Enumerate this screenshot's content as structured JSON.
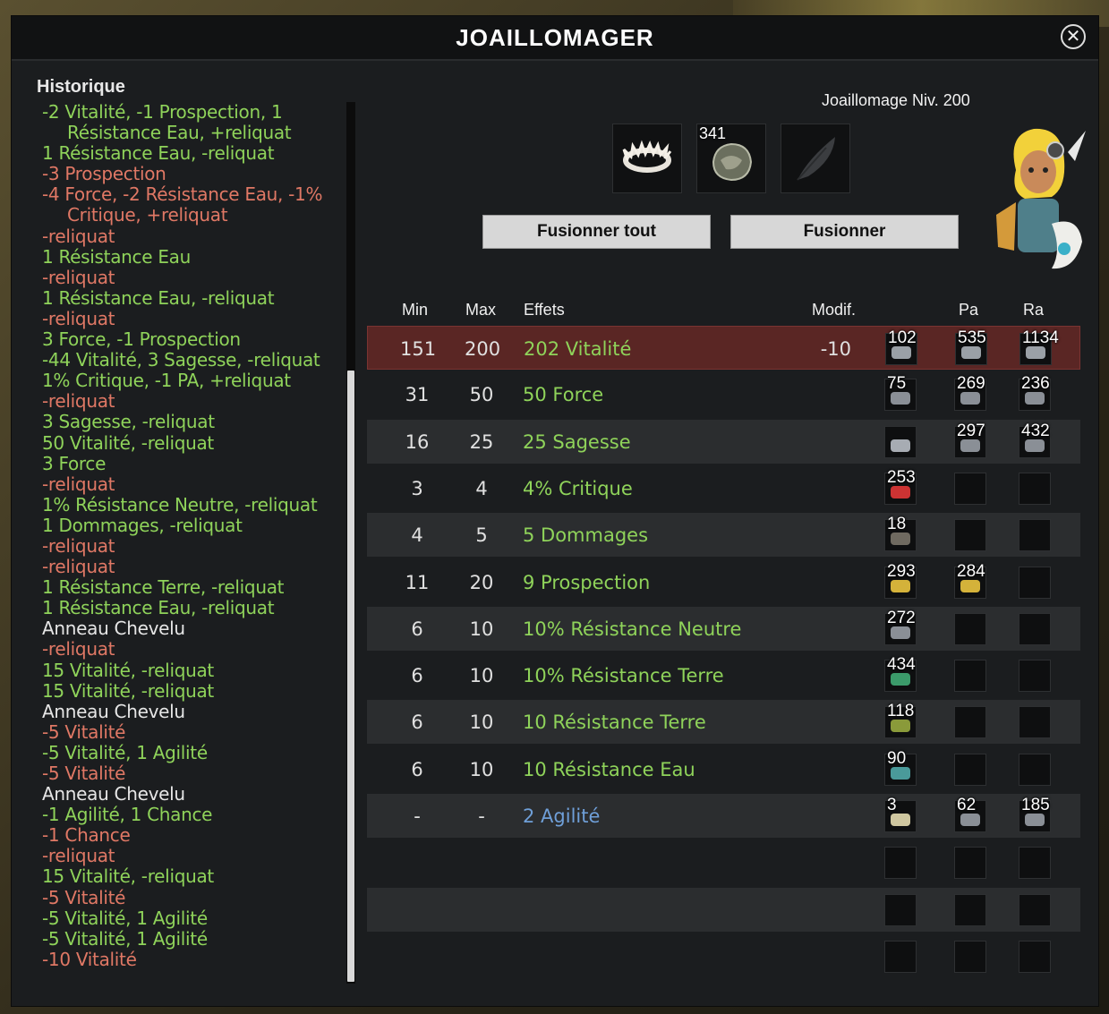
{
  "window": {
    "title": "JOAILLOMAGER",
    "close_label": "✕"
  },
  "history": {
    "title": "Historique",
    "entries": [
      {
        "text": "-2 Vitalité, -1 Prospection, 1 Résistance Eau, +reliquat",
        "kind": "pos"
      },
      {
        "text": "1 Résistance Eau, -reliquat",
        "kind": "pos"
      },
      {
        "text": "-3 Prospection",
        "kind": "neg"
      },
      {
        "text": "-4 Force, -2 Résistance Eau, -1% Critique, +reliquat",
        "kind": "neg"
      },
      {
        "text": "-reliquat",
        "kind": "neg"
      },
      {
        "text": "1 Résistance Eau",
        "kind": "pos"
      },
      {
        "text": "-reliquat",
        "kind": "neg"
      },
      {
        "text": "1 Résistance Eau, -reliquat",
        "kind": "pos"
      },
      {
        "text": "-reliquat",
        "kind": "neg"
      },
      {
        "text": "3 Force, -1 Prospection",
        "kind": "pos"
      },
      {
        "text": "-44 Vitalité, 3 Sagesse, -reliquat",
        "kind": "pos"
      },
      {
        "text": "1% Critique, -1 PA, +reliquat",
        "kind": "pos"
      },
      {
        "text": "-reliquat",
        "kind": "neg"
      },
      {
        "text": "3 Sagesse, -reliquat",
        "kind": "pos"
      },
      {
        "text": "50 Vitalité, -reliquat",
        "kind": "pos"
      },
      {
        "text": "3 Force",
        "kind": "pos"
      },
      {
        "text": "-reliquat",
        "kind": "neg"
      },
      {
        "text": "1% Résistance Neutre, -reliquat",
        "kind": "pos"
      },
      {
        "text": "1 Dommages, -reliquat",
        "kind": "pos"
      },
      {
        "text": "-reliquat",
        "kind": "neg"
      },
      {
        "text": "-reliquat",
        "kind": "neg"
      },
      {
        "text": "1 Résistance Terre, -reliquat",
        "kind": "pos"
      },
      {
        "text": "1 Résistance Eau, -reliquat",
        "kind": "pos"
      },
      {
        "text": "Anneau Chevelu",
        "kind": "item"
      },
      {
        "text": "-reliquat",
        "kind": "neg"
      },
      {
        "text": "15 Vitalité, -reliquat",
        "kind": "pos"
      },
      {
        "text": "15 Vitalité, -reliquat",
        "kind": "pos"
      },
      {
        "text": "Anneau Chevelu",
        "kind": "item"
      },
      {
        "text": "-5 Vitalité",
        "kind": "neg"
      },
      {
        "text": "-5 Vitalité, 1 Agilité",
        "kind": "pos"
      },
      {
        "text": "-5 Vitalité",
        "kind": "neg"
      },
      {
        "text": "Anneau Chevelu",
        "kind": "item"
      },
      {
        "text": "-1 Agilité, 1 Chance",
        "kind": "pos"
      },
      {
        "text": "-1 Chance",
        "kind": "neg"
      },
      {
        "text": "-reliquat",
        "kind": "neg"
      },
      {
        "text": "15 Vitalité, -reliquat",
        "kind": "pos"
      },
      {
        "text": "-5 Vitalité",
        "kind": "neg"
      },
      {
        "text": "-5 Vitalité, 1 Agilité",
        "kind": "pos"
      },
      {
        "text": "-5 Vitalité, 1 Agilité",
        "kind": "pos"
      },
      {
        "text": "-10 Vitalité",
        "kind": "neg"
      }
    ]
  },
  "craft": {
    "level_label": "Joaillomage Niv. 200",
    "slots": [
      {
        "icon": "ring-item-icon",
        "count": ""
      },
      {
        "icon": "rune-stack-icon",
        "count": "341"
      },
      {
        "icon": "feather-placeholder-icon",
        "count": ""
      }
    ],
    "merge_all_label": "Fusionner tout",
    "merge_label": "Fusionner"
  },
  "table": {
    "headers": {
      "min": "Min",
      "max": "Max",
      "effects": "Effets",
      "modif": "Modif.",
      "pa": "Pa",
      "ra": "Ra"
    },
    "rows": [
      {
        "min": "151",
        "max": "200",
        "effect": "202 Vitalité",
        "modif": "-10",
        "color": "green",
        "selected": true,
        "runes": [
          {
            "n": "102",
            "c": "#9aa0a6"
          },
          {
            "n": "535",
            "c": "#9aa0a6"
          },
          {
            "n": "1134",
            "c": "#9aa0a6"
          }
        ]
      },
      {
        "min": "31",
        "max": "50",
        "effect": "50 Force",
        "modif": "",
        "color": "green",
        "runes": [
          {
            "n": "75",
            "c": "#8a8f96"
          },
          {
            "n": "269",
            "c": "#8a8f96"
          },
          {
            "n": "236",
            "c": "#8a8f96"
          }
        ]
      },
      {
        "min": "16",
        "max": "25",
        "effect": "25 Sagesse",
        "modif": "",
        "color": "green",
        "runes": [
          {
            "n": "",
            "c": "#a7acb3"
          },
          {
            "n": "297",
            "c": "#8a8f96"
          },
          {
            "n": "432",
            "c": "#8a8f96"
          }
        ]
      },
      {
        "min": "3",
        "max": "4",
        "effect": "4% Critique",
        "modif": "",
        "color": "green",
        "runes": [
          {
            "n": "253",
            "c": "#c33"
          },
          {
            "n": "",
            "c": ""
          },
          {
            "n": "",
            "c": ""
          }
        ]
      },
      {
        "min": "4",
        "max": "5",
        "effect": "5 Dommages",
        "modif": "",
        "color": "green",
        "runes": [
          {
            "n": "18",
            "c": "#6f6a60"
          },
          {
            "n": "",
            "c": ""
          },
          {
            "n": "",
            "c": ""
          }
        ]
      },
      {
        "min": "11",
        "max": "20",
        "effect": "9 Prospection",
        "modif": "",
        "color": "green",
        "runes": [
          {
            "n": "293",
            "c": "#d4b23a"
          },
          {
            "n": "284",
            "c": "#d4b23a"
          },
          {
            "n": "",
            "c": ""
          }
        ]
      },
      {
        "min": "6",
        "max": "10",
        "effect": "10% Résistance Neutre",
        "modif": "",
        "color": "green",
        "runes": [
          {
            "n": "272",
            "c": "#8a8f96"
          },
          {
            "n": "",
            "c": ""
          },
          {
            "n": "",
            "c": ""
          }
        ]
      },
      {
        "min": "6",
        "max": "10",
        "effect": "10% Résistance Terre",
        "modif": "",
        "color": "green",
        "runes": [
          {
            "n": "434",
            "c": "#3b9a6a"
          },
          {
            "n": "",
            "c": ""
          },
          {
            "n": "",
            "c": ""
          }
        ]
      },
      {
        "min": "6",
        "max": "10",
        "effect": "10 Résistance Terre",
        "modif": "",
        "color": "green",
        "runes": [
          {
            "n": "118",
            "c": "#8a9a3a"
          },
          {
            "n": "",
            "c": ""
          },
          {
            "n": "",
            "c": ""
          }
        ]
      },
      {
        "min": "6",
        "max": "10",
        "effect": "10 Résistance Eau",
        "modif": "",
        "color": "green",
        "runes": [
          {
            "n": "90",
            "c": "#4a9a9a"
          },
          {
            "n": "",
            "c": ""
          },
          {
            "n": "",
            "c": ""
          }
        ]
      },
      {
        "min": "-",
        "max": "-",
        "effect": "2 Agilité",
        "modif": "",
        "color": "blue",
        "runes": [
          {
            "n": "3",
            "c": "#cfc7a0"
          },
          {
            "n": "62",
            "c": "#8a8f96"
          },
          {
            "n": "185",
            "c": "#8a8f96"
          }
        ]
      },
      {
        "min": "",
        "max": "",
        "effect": "",
        "modif": "",
        "color": "green",
        "runes": [
          {
            "n": "",
            "c": ""
          },
          {
            "n": "",
            "c": ""
          },
          {
            "n": "",
            "c": ""
          }
        ]
      },
      {
        "min": "",
        "max": "",
        "effect": "",
        "modif": "",
        "color": "green",
        "runes": [
          {
            "n": "",
            "c": ""
          },
          {
            "n": "",
            "c": ""
          },
          {
            "n": "",
            "c": ""
          }
        ]
      },
      {
        "min": "",
        "max": "",
        "effect": "",
        "modif": "",
        "color": "green",
        "runes": [
          {
            "n": "",
            "c": ""
          },
          {
            "n": "",
            "c": ""
          },
          {
            "n": "",
            "c": ""
          }
        ]
      }
    ]
  }
}
